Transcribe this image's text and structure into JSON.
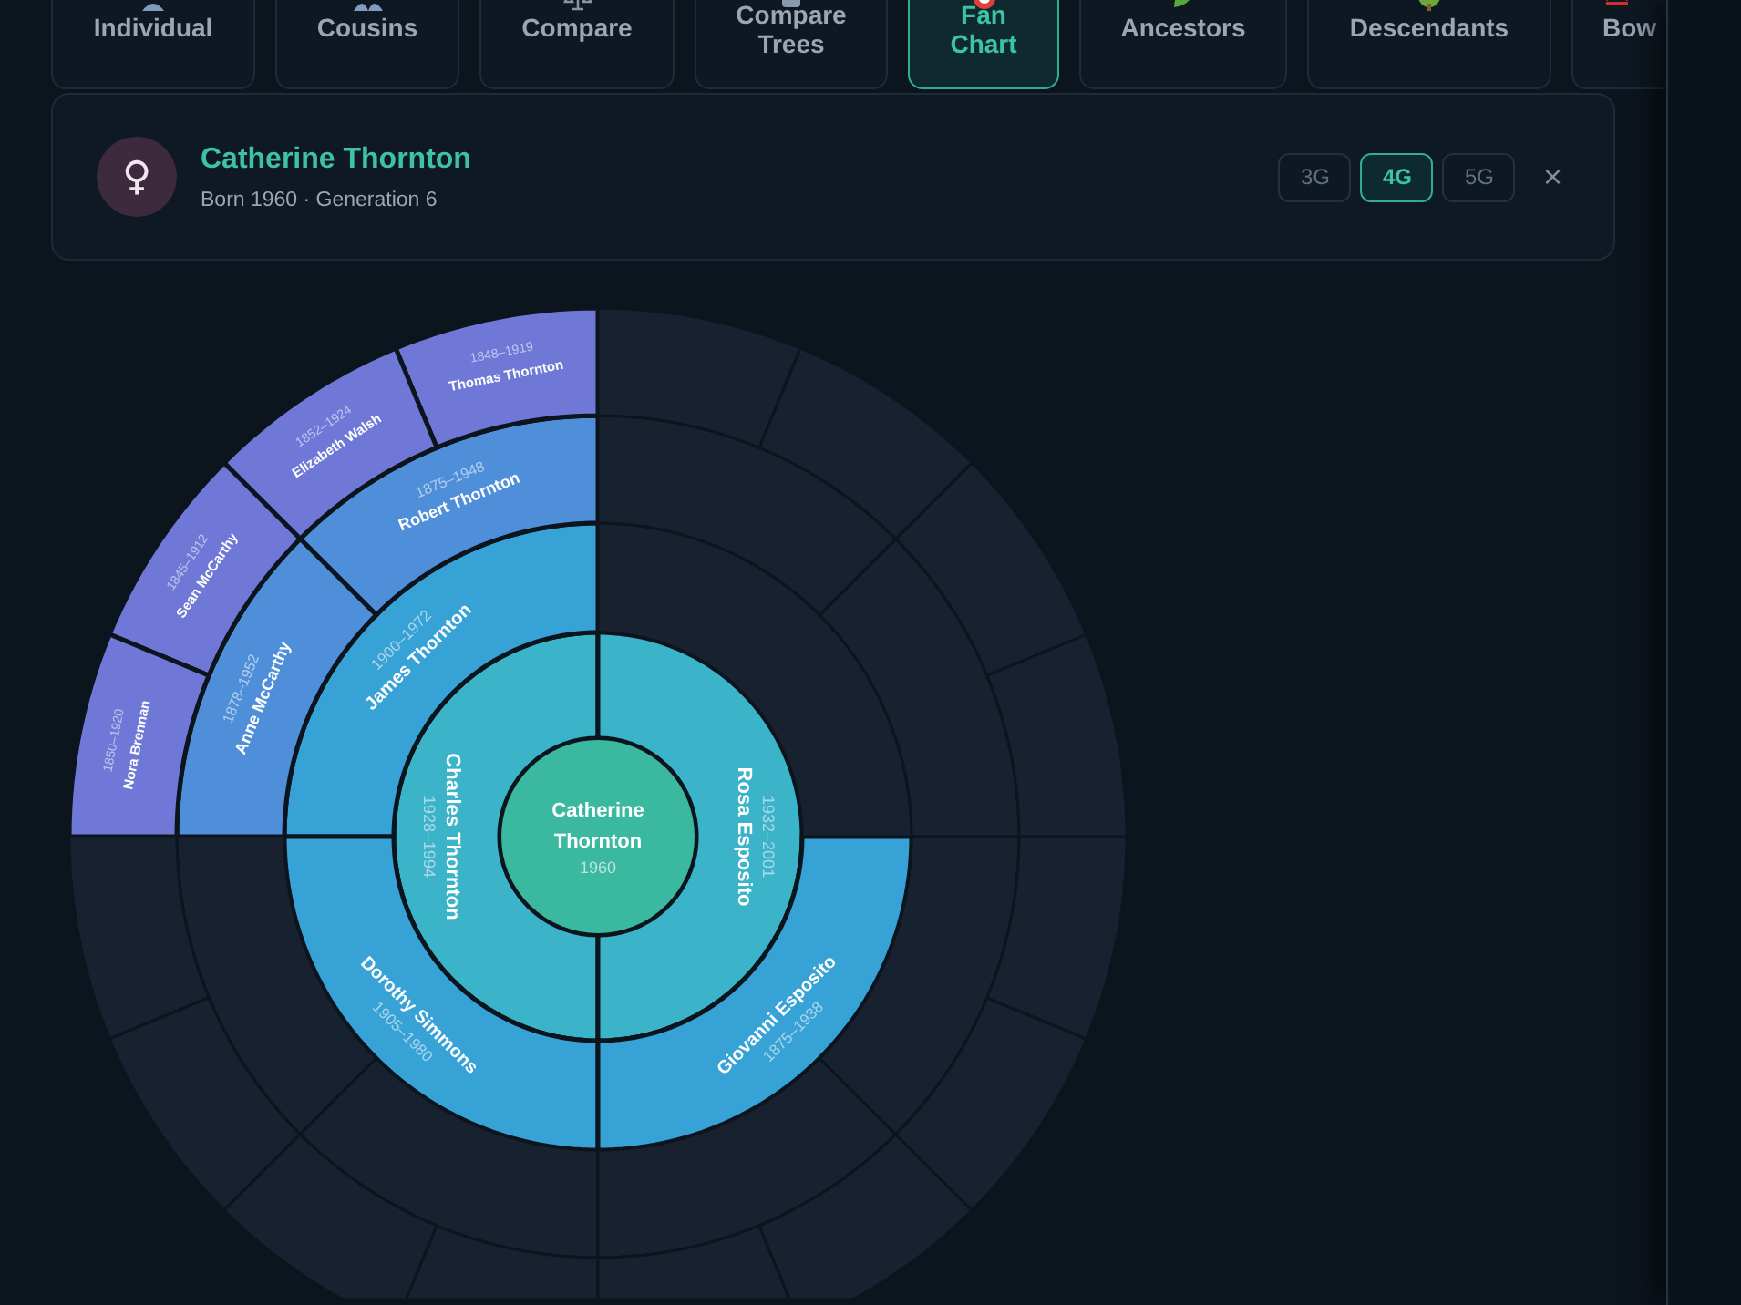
{
  "tabs": [
    {
      "label": "Individual",
      "selected": false
    },
    {
      "label": "Cousins",
      "selected": false
    },
    {
      "label": "Compare",
      "selected": false
    },
    {
      "label": "Compare Trees",
      "selected": false
    },
    {
      "label": "Fan Chart",
      "selected": true
    },
    {
      "label": "Ancestors",
      "selected": false
    },
    {
      "label": "Descendants",
      "selected": false
    },
    {
      "label": "Bow",
      "selected": false
    }
  ],
  "person": {
    "symbol": "♀",
    "name": "Catherine Thornton",
    "subtitle": "Born 1960 · Generation 6"
  },
  "generation_buttons": [
    {
      "label": "3G",
      "selected": false
    },
    {
      "label": "4G",
      "selected": true
    },
    {
      "label": "5G",
      "selected": false
    }
  ],
  "close": "×",
  "fan_chart": {
    "center": {
      "name": "Catherine Thornton",
      "dates": "1960"
    },
    "rings": [
      [
        {
          "kind": "person",
          "name": "Charles Thornton",
          "dates": "1928–1994"
        },
        {
          "kind": "person",
          "name": "Rosa Esposito",
          "dates": "1932–2001"
        }
      ],
      [
        {
          "kind": "person",
          "name": "James Thornton",
          "dates": "1900–1972"
        },
        {
          "kind": "person",
          "name": "Dorothy Simmons",
          "dates": "1905–1980"
        },
        {
          "kind": "person",
          "name": "Giovanni Esposito",
          "dates": "1875–1938"
        },
        {
          "kind": "empty"
        }
      ],
      [
        {
          "kind": "person",
          "name": "Robert Thornton",
          "dates": "1875–1948"
        },
        {
          "kind": "person",
          "name": "Anne McCarthy",
          "dates": "1878–1952"
        },
        {
          "kind": "empty"
        },
        {
          "kind": "empty"
        },
        {
          "kind": "empty"
        },
        {
          "kind": "empty"
        },
        {
          "kind": "empty"
        },
        {
          "kind": "empty"
        }
      ],
      [
        {
          "kind": "person",
          "name": "Thomas Thornton",
          "dates": "1848–1919"
        },
        {
          "kind": "person",
          "name": "Elizabeth Walsh",
          "dates": "1852–1924"
        },
        {
          "kind": "person",
          "name": "Sean McCarthy",
          "dates": "1845–1912"
        },
        {
          "kind": "person",
          "name": "Nora Brennan",
          "dates": "1850–1920"
        },
        {
          "kind": "empty"
        },
        {
          "kind": "empty"
        },
        {
          "kind": "empty"
        },
        {
          "kind": "empty"
        },
        {
          "kind": "empty"
        },
        {
          "kind": "empty"
        },
        {
          "kind": "empty"
        },
        {
          "kind": "empty"
        },
        {
          "kind": "empty"
        },
        {
          "kind": "empty"
        },
        {
          "kind": "empty"
        },
        {
          "kind": "empty"
        }
      ]
    ]
  }
}
